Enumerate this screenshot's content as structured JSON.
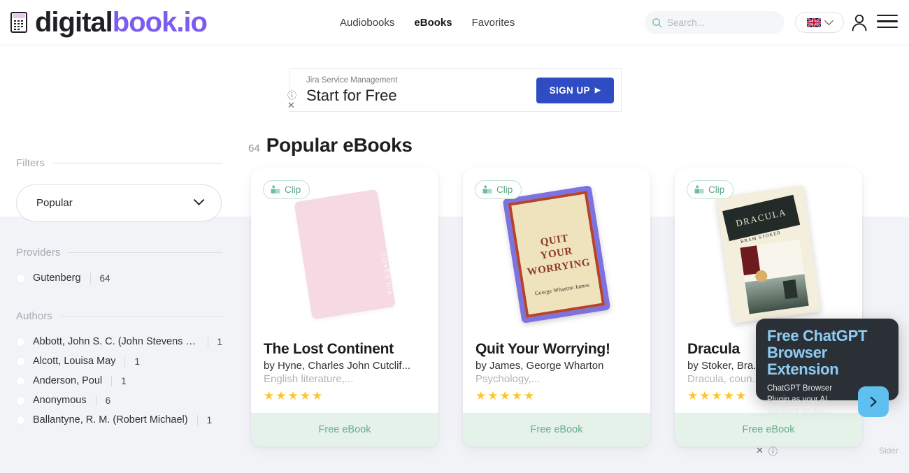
{
  "header": {
    "logo": {
      "dark": "digital",
      "purple": "book.io",
      "icon": "book-logo-icon"
    },
    "nav": [
      {
        "label": "Audiobooks",
        "active": false
      },
      {
        "label": "eBooks",
        "active": true
      },
      {
        "label": "Favorites",
        "active": false
      }
    ],
    "search": {
      "placeholder": "Search...",
      "value": "",
      "icon": "search-icon",
      "clear": "✕"
    },
    "language": {
      "flag": "uk-flag-icon",
      "chevron": "chevron-down-icon"
    },
    "account_icon": "user-icon",
    "menu_icon": "hamburger-menu-icon"
  },
  "ad_banner": {
    "kicker": "Jira Service Management",
    "headline": "Start for Free",
    "button_label": "SIGN UP",
    "button_arrow": "▶",
    "info_icon": "ⓘ",
    "close_icon": "✕",
    "button_color": "#2f4cc4"
  },
  "sidebar": {
    "filters_title": "Filters",
    "sort_select": {
      "value": "Popular",
      "chevron": "chevron-down-icon"
    },
    "providers_title": "Providers",
    "providers": [
      {
        "label": "Gutenberg",
        "count": "64"
      }
    ],
    "authors_title": "Authors",
    "authors": [
      {
        "label": "Abbott, John S. C. (John Stevens Ca...",
        "count": "1"
      },
      {
        "label": "Alcott, Louisa May",
        "count": "1"
      },
      {
        "label": "Anderson, Poul",
        "count": "1"
      },
      {
        "label": "Anonymous",
        "count": "6"
      },
      {
        "label": "Ballantyne, R. M. (Robert Michael)",
        "count": "1"
      }
    ]
  },
  "main": {
    "count": "64",
    "title": "Popular eBooks",
    "cards": [
      {
        "clip_label": "Clip",
        "cover_kind": "placeholder",
        "cover_text": "COVER N/A",
        "title": "The Lost Continent",
        "author": "by Hyne, Charles John Cutclif...",
        "subject": "English literature,...",
        "stars": 5,
        "footer": "Free eBook"
      },
      {
        "clip_label": "Clip",
        "cover_kind": "quit-your-worrying",
        "cover_title_lines": [
          "QUIT",
          "YOUR",
          "WORRYING"
        ],
        "cover_author": "George Wharton James",
        "title": "Quit Your Worrying!",
        "author": "by James, George Wharton",
        "subject": "Psychology,...",
        "stars": 5,
        "footer": "Free eBook"
      },
      {
        "clip_label": "Clip",
        "cover_kind": "dracula",
        "cover_title": "DRACULA",
        "cover_author": "BRAM STOKER",
        "title": "Dracula",
        "author": "by Stoker, Bra...",
        "subject": "Dracula, coun...",
        "stars": 5,
        "footer": "Free eBook"
      }
    ]
  },
  "sider_ad": {
    "headline": "Free ChatGPT Browser Extension",
    "body": "ChatGPT Browser Plugin as your AI assistant on any...",
    "cta_icon": "›",
    "close_icon": "✕",
    "info_icon": "ⓘ",
    "brand": "Sider",
    "accent": "#8ecdf3"
  },
  "star_glyph": "★"
}
